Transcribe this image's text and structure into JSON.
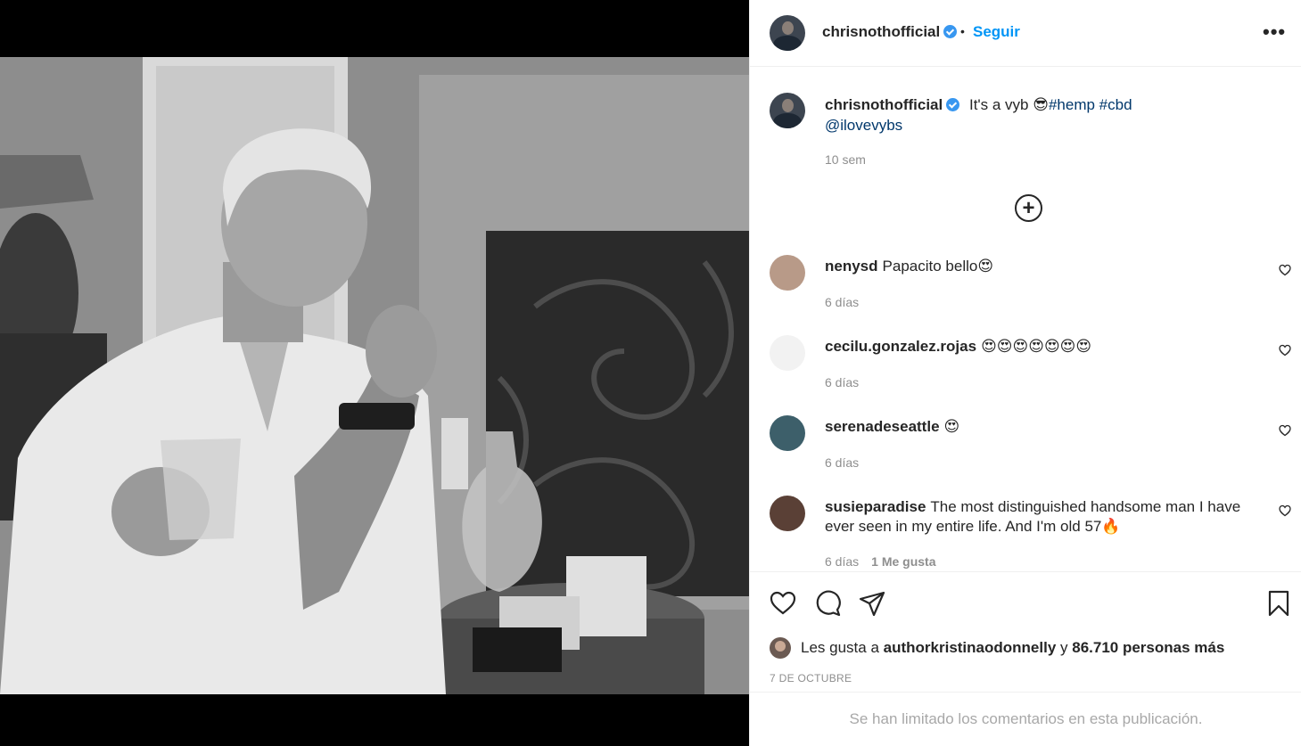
{
  "post": {
    "username": "chrisnothofficial",
    "follow_label": "Seguir",
    "separator": "•",
    "more_label": "•••",
    "caption": {
      "text": "It's a vyb 😎",
      "tags": "#hemp #cbd",
      "mention": "@ilovevybs",
      "time": "10 sem"
    },
    "load_more_label": "+"
  },
  "comments": [
    {
      "username": "nenysd",
      "text": "Papacito bello😍",
      "time": "6 días",
      "likes": "",
      "avatar_color": "#b89a88"
    },
    {
      "username": "cecilu.gonzalez.rojas",
      "text": "😍😍😍😍😍😍😍",
      "time": "6 días",
      "likes": "",
      "avatar_color": "#f2f2f2"
    },
    {
      "username": "serenadeseattle",
      "text": "😍",
      "time": "6 días",
      "likes": "",
      "avatar_color": "#3d5f6a"
    },
    {
      "username": "susieparadise",
      "text": "The most distinguished handsome man I have ever seen in my entire life. And I'm old 57🔥",
      "time": "6 días",
      "likes": "1 Me gusta",
      "avatar_color": "#5a4036"
    }
  ],
  "likes": {
    "prefix": "Les gusta a",
    "user": "authorkristinaodonnelly",
    "joiner": "y",
    "count": "86.710 personas más"
  },
  "date": "7 DE OCTUBRE",
  "comments_limited": "Se han limitado los comentarios en esta publicación.",
  "icons": [
    "user-tag-icon",
    "verified-icon",
    "more-icon",
    "add-circle-icon",
    "heart-icon",
    "comment-icon",
    "share-icon",
    "bookmark-icon"
  ],
  "colors": {
    "link": "#0095f6",
    "hashtag": "#00376b",
    "muted": "#8e8e8e",
    "verified": "#3897f0"
  }
}
